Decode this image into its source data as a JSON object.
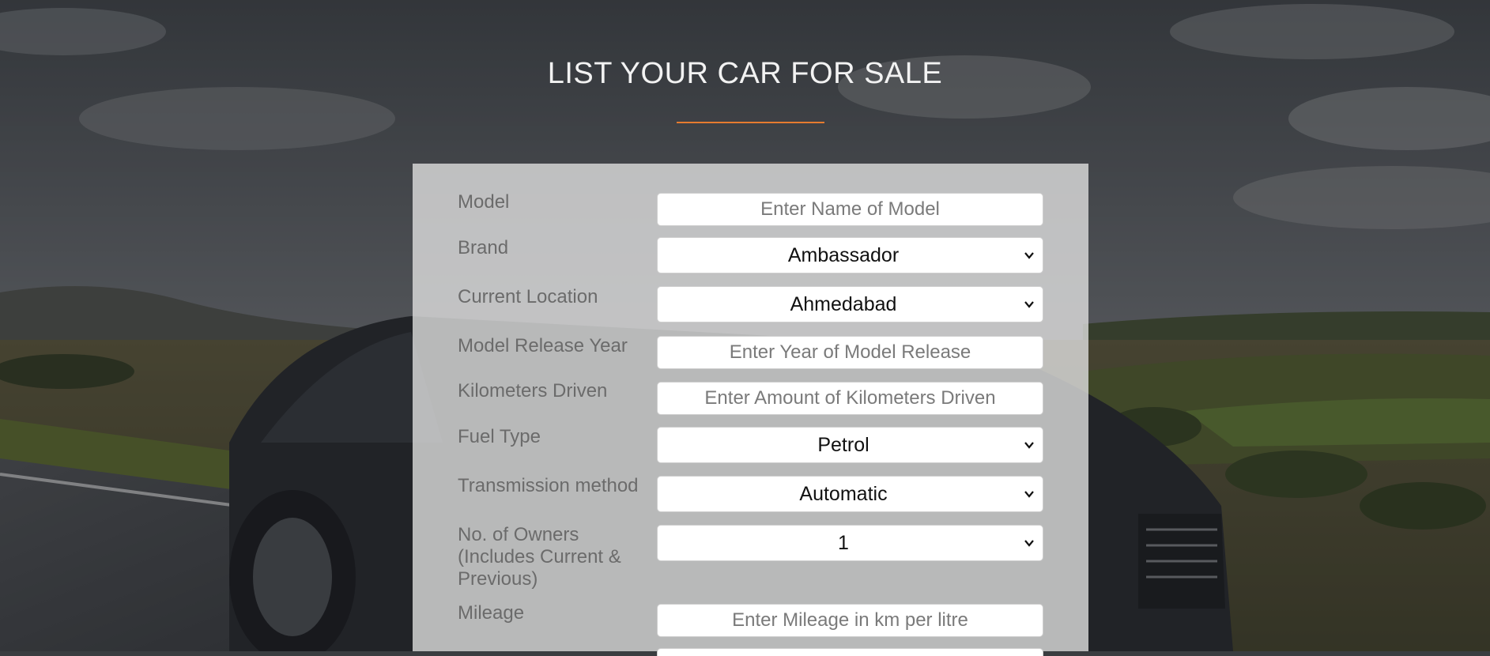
{
  "page": {
    "title": "LIST YOUR CAR FOR SALE",
    "accent_color": "#e57b2f"
  },
  "form": {
    "fields": {
      "model": {
        "label": "Model",
        "placeholder": "Enter Name of Model",
        "value": ""
      },
      "brand": {
        "label": "Brand",
        "selected": "Ambassador"
      },
      "location": {
        "label": "Current Location",
        "selected": "Ahmedabad"
      },
      "release_year": {
        "label": "Model Release Year",
        "placeholder": "Enter Year of Model Release",
        "value": ""
      },
      "kilometers": {
        "label": "Kilometers Driven",
        "placeholder": "Enter Amount of Kilometers Driven",
        "value": ""
      },
      "fuel_type": {
        "label": "Fuel Type",
        "selected": "Petrol"
      },
      "transmission": {
        "label": "Transmission method",
        "selected": "Automatic"
      },
      "owners": {
        "label": "No. of Owners (Includes Current & Previous)",
        "selected": "1"
      },
      "mileage": {
        "label": "Mileage",
        "placeholder": "Enter Mileage in km per litre",
        "value": ""
      }
    }
  },
  "icons": {
    "select_arrow": "chevron-down-icon"
  }
}
